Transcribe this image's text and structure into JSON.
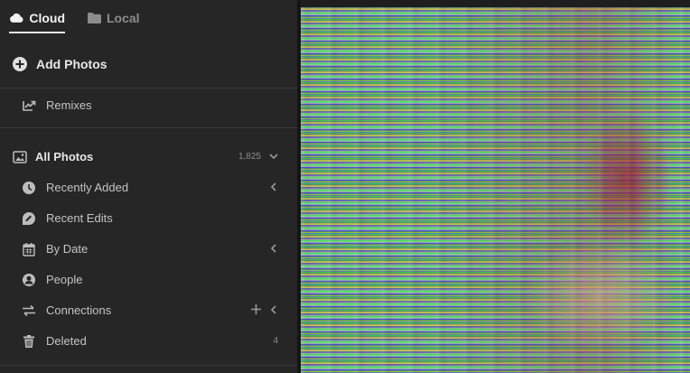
{
  "tabs": [
    {
      "label": "Cloud",
      "icon": "cloud-icon",
      "active": true
    },
    {
      "label": "Local",
      "icon": "folder-icon",
      "active": false
    }
  ],
  "add_photos": {
    "label": "Add Photos",
    "icon": "plus-circle-icon"
  },
  "remixes": {
    "label": "Remixes",
    "icon": "remix-icon"
  },
  "library": {
    "all_photos": {
      "label": "All Photos",
      "count": "1,825",
      "icon": "photo-icon"
    },
    "items": [
      {
        "label": "Recently Added",
        "icon": "clock-icon"
      },
      {
        "label": "Recent Edits",
        "icon": "edit-tag-icon"
      },
      {
        "label": "By Date",
        "icon": "calendar-icon"
      },
      {
        "label": "People",
        "icon": "person-icon"
      },
      {
        "label": "Connections",
        "icon": "connections-icon"
      },
      {
        "label": "Deleted",
        "icon": "trash-icon",
        "count": "4"
      }
    ]
  },
  "colors": {
    "sidebar_bg": "#262626",
    "text": "#c4c4c4",
    "active_text": "#f2f2f2"
  }
}
